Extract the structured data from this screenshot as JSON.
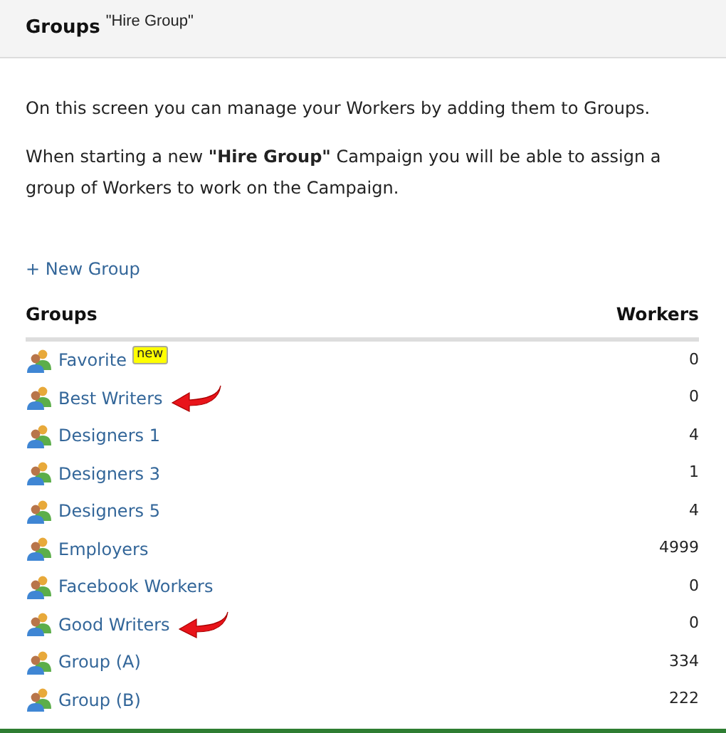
{
  "header": {
    "title": "Groups",
    "subtitle": "\"Hire Group\""
  },
  "intro": [
    "On this screen you can manage your Workers by adding them to Groups.",
    "When starting a new **\"Hire Group\"** Campaign you will be able to assign a group of Workers to work on the Campaign."
  ],
  "new_group_link": "+ New Group",
  "table": {
    "columns": [
      "Groups",
      "Workers"
    ],
    "rows": [
      {
        "name": "Favorite",
        "badge": "new",
        "workers": "0",
        "arrow": false
      },
      {
        "name": "Best Writers",
        "workers": "0",
        "arrow": true
      },
      {
        "name": "Designers 1",
        "workers": "4",
        "arrow": false
      },
      {
        "name": "Designers 3",
        "workers": "1",
        "arrow": false
      },
      {
        "name": "Designers 5",
        "workers": "4",
        "arrow": false
      },
      {
        "name": "Employers",
        "workers": "4999",
        "arrow": false
      },
      {
        "name": "Facebook Workers",
        "workers": "0",
        "arrow": false
      },
      {
        "name": "Good Writers",
        "workers": "0",
        "arrow": true
      },
      {
        "name": "Group (A)",
        "workers": "334",
        "arrow": false
      },
      {
        "name": "Group (B)",
        "workers": "222",
        "arrow": false
      }
    ]
  }
}
